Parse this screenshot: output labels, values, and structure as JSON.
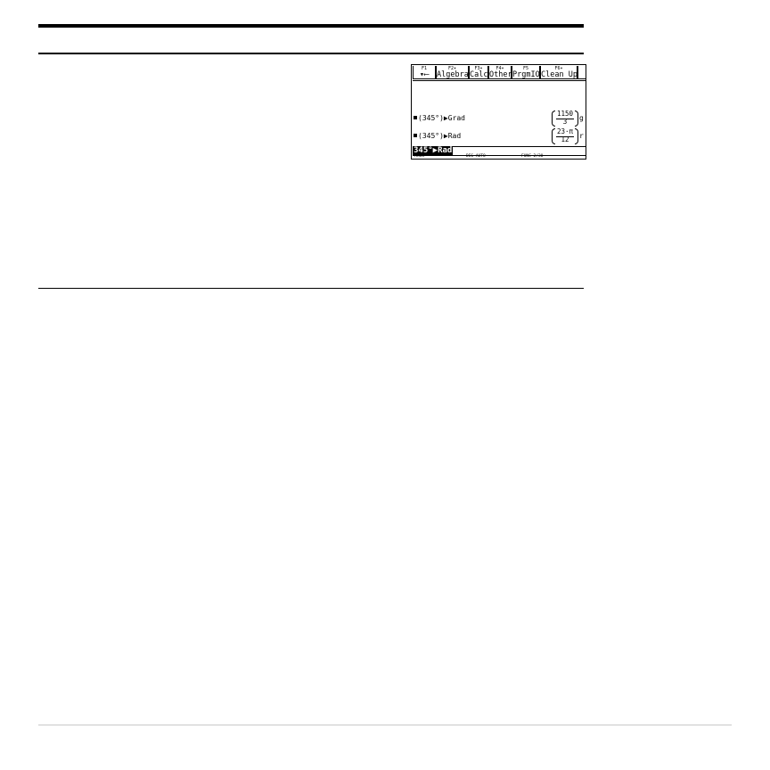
{
  "toolbar": {
    "f1": {
      "key": "F1",
      "label": "▾⟵"
    },
    "f2": {
      "key": "F2▾",
      "label": "Algebra"
    },
    "f3": {
      "key": "F3▾",
      "label": "Calc"
    },
    "f4": {
      "key": "F4▾",
      "label": "Other"
    },
    "f5": {
      "key": "F5",
      "label": "PrgmIO"
    },
    "f6": {
      "key": "F6▾",
      "label": "Clean Up"
    }
  },
  "history": [
    {
      "input": "(345°)▶Grad",
      "numerator": "1150",
      "denominator": "3",
      "suffix": "g"
    },
    {
      "input": "(345°)▶Rad",
      "numerator": "23·π",
      "denominator": "12",
      "suffix": "r"
    }
  ],
  "command_line": "345°▶Rad",
  "status": {
    "folder": "MAIN",
    "mode": "DEG AUTO",
    "func": "FUNC 2/30"
  }
}
